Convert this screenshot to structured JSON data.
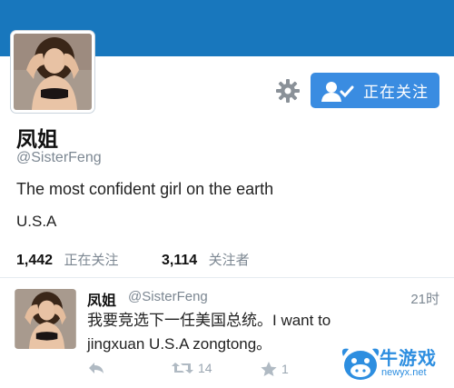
{
  "profile": {
    "name": "凤姐",
    "handle": "@SisterFeng",
    "bio": "The most confident girl on the earth",
    "location": "U.S.A",
    "following_label": "正在关注",
    "following_count": "1,442",
    "followers_label": "关注者",
    "followers_count": "3,114",
    "follow_button_label": "正在关注",
    "banner_color": "#1877bd",
    "button_color": "#3a8ce1"
  },
  "tweet": {
    "name": "凤姐",
    "handle": "@SisterFeng",
    "time": "21时",
    "text": "我要竞选下一任美国总统。I want to jingxuan U.S.A zongtong。",
    "retweets": "14",
    "favorites": "1"
  },
  "watermark": {
    "text": "牛游戏",
    "url": "newyx.net"
  },
  "icons": [
    "gear-icon",
    "follow-user-icon",
    "reply-icon",
    "retweet-icon",
    "star-icon"
  ]
}
